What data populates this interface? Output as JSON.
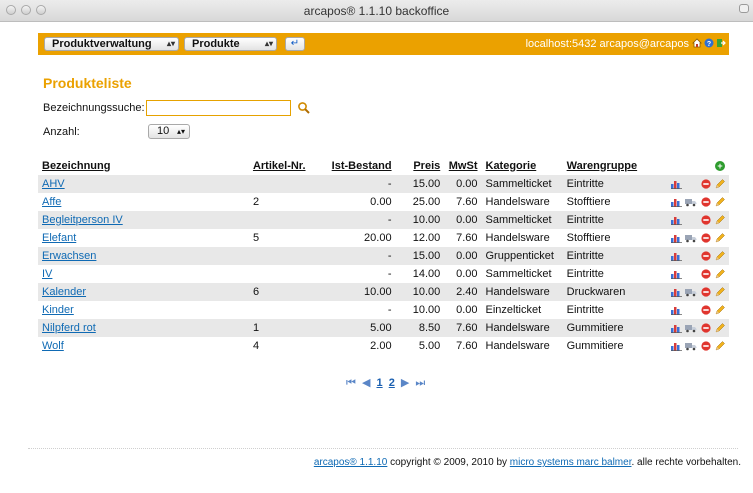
{
  "window": {
    "title": "arcapos® 1.1.10 backoffice"
  },
  "toolbar": {
    "module_select": "Produktverwaltung",
    "page_select": "Produkte",
    "return_symbol": "↵",
    "connection": "localhost:5432 arcapos@arcapos",
    "icons": [
      "home-icon",
      "help-icon",
      "logout-icon"
    ],
    "accent": "#eba100"
  },
  "main": {
    "title": "Produkteliste",
    "search": {
      "label": "Bezeichnungssuche:",
      "value": "",
      "placeholder": ""
    },
    "count": {
      "label": "Anzahl:",
      "value": "10"
    }
  },
  "table": {
    "headers": [
      "Bezeichnung",
      "Artikel-Nr.",
      "Ist-Bestand",
      "Preis",
      "MwSt",
      "Kategorie",
      "Warengruppe"
    ],
    "rows": [
      {
        "name": "AHV",
        "artnr": "",
        "stock": "-",
        "price": "15.00",
        "vat": "0.00",
        "category": "Sammelticket",
        "group": "Eintritte",
        "truck": false
      },
      {
        "name": "Affe",
        "artnr": "2",
        "stock": "0.00",
        "price": "25.00",
        "vat": "7.60",
        "category": "Handelsware",
        "group": "Stofftiere",
        "truck": true
      },
      {
        "name": "Begleitperson IV",
        "artnr": "",
        "stock": "-",
        "price": "10.00",
        "vat": "0.00",
        "category": "Sammelticket",
        "group": "Eintritte",
        "truck": false
      },
      {
        "name": "Elefant",
        "artnr": "5",
        "stock": "20.00",
        "price": "12.00",
        "vat": "7.60",
        "category": "Handelsware",
        "group": "Stofftiere",
        "truck": true
      },
      {
        "name": "Erwachsen",
        "artnr": "",
        "stock": "-",
        "price": "15.00",
        "vat": "0.00",
        "category": "Gruppenticket",
        "group": "Eintritte",
        "truck": false
      },
      {
        "name": "IV",
        "artnr": "",
        "stock": "-",
        "price": "14.00",
        "vat": "0.00",
        "category": "Sammelticket",
        "group": "Eintritte",
        "truck": false
      },
      {
        "name": "Kalender",
        "artnr": "6",
        "stock": "10.00",
        "price": "10.00",
        "vat": "2.40",
        "category": "Handelsware",
        "group": "Druckwaren",
        "truck": true
      },
      {
        "name": "Kinder",
        "artnr": "",
        "stock": "-",
        "price": "10.00",
        "vat": "0.00",
        "category": "Einzelticket",
        "group": "Eintritte",
        "truck": false
      },
      {
        "name": "Nilpferd rot",
        "artnr": "1",
        "stock": "5.00",
        "price": "8.50",
        "vat": "7.60",
        "category": "Handelsware",
        "group": "Gummitiere",
        "truck": true
      },
      {
        "name": "Wolf",
        "artnr": "4",
        "stock": "2.00",
        "price": "5.00",
        "vat": "7.60",
        "category": "Handelsware",
        "group": "Gummitiere",
        "truck": true
      }
    ]
  },
  "pager": {
    "first": "⏮",
    "prev": "◀",
    "pages": [
      "1",
      "2"
    ],
    "next": "▶",
    "last": "⏭"
  },
  "footer": {
    "product_link": "arcapos® 1.1.10",
    "copyright": "copyright © 2009, 2010 by",
    "company_link": "micro systems marc balmer",
    "rights": ". alle rechte vorbehalten."
  }
}
